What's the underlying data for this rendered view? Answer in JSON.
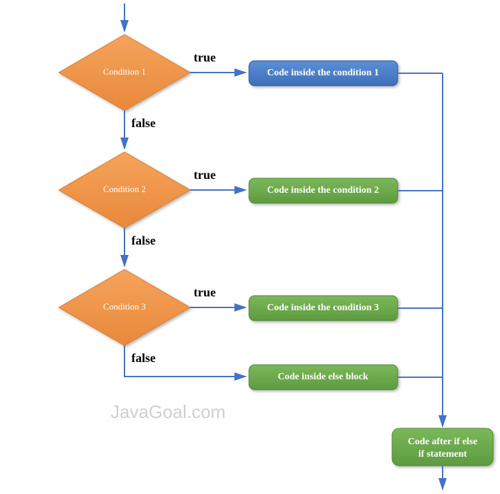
{
  "chart_data": {
    "type": "flowchart",
    "nodes": [
      {
        "id": "cond1",
        "type": "decision",
        "label": "Condition 1"
      },
      {
        "id": "cond2",
        "type": "decision",
        "label": "Condition 2"
      },
      {
        "id": "cond3",
        "type": "decision",
        "label": "Condition 3"
      },
      {
        "id": "code1",
        "type": "process",
        "label": "Code inside the condition 1",
        "color": "blue"
      },
      {
        "id": "code2",
        "type": "process",
        "label": "Code inside the condition 2",
        "color": "green"
      },
      {
        "id": "code3",
        "type": "process",
        "label": "Code inside the condition 3",
        "color": "green"
      },
      {
        "id": "codeElse",
        "type": "process",
        "label": "Code inside else block",
        "color": "green"
      },
      {
        "id": "codeAfter",
        "type": "process",
        "label_line1": "Code after if else",
        "label_line2": "if statement",
        "color": "green"
      }
    ],
    "edges": [
      {
        "from": "start",
        "to": "cond1"
      },
      {
        "from": "cond1",
        "to": "code1",
        "label": "true"
      },
      {
        "from": "cond1",
        "to": "cond2",
        "label": "false"
      },
      {
        "from": "cond2",
        "to": "code2",
        "label": "true"
      },
      {
        "from": "cond2",
        "to": "cond3",
        "label": "false"
      },
      {
        "from": "cond3",
        "to": "code3",
        "label": "true"
      },
      {
        "from": "cond3",
        "to": "codeElse",
        "label": "false"
      },
      {
        "from": "code1",
        "to": "codeAfter"
      },
      {
        "from": "code2",
        "to": "codeAfter"
      },
      {
        "from": "code3",
        "to": "codeAfter"
      },
      {
        "from": "codeElse",
        "to": "codeAfter"
      },
      {
        "from": "codeAfter",
        "to": "end"
      }
    ]
  },
  "labels": {
    "cond1": "Condition 1",
    "cond2": "Condition 2",
    "cond3": "Condition 3",
    "code1": "Code inside the condition 1",
    "code2": "Code inside the condition 2",
    "code3": "Code inside the condition 3",
    "codeElse": "Code inside else block",
    "codeAfter1": "Code after if else",
    "codeAfter2": "if statement",
    "true": "true",
    "false": "false"
  },
  "watermark": "JavaGoal.com"
}
